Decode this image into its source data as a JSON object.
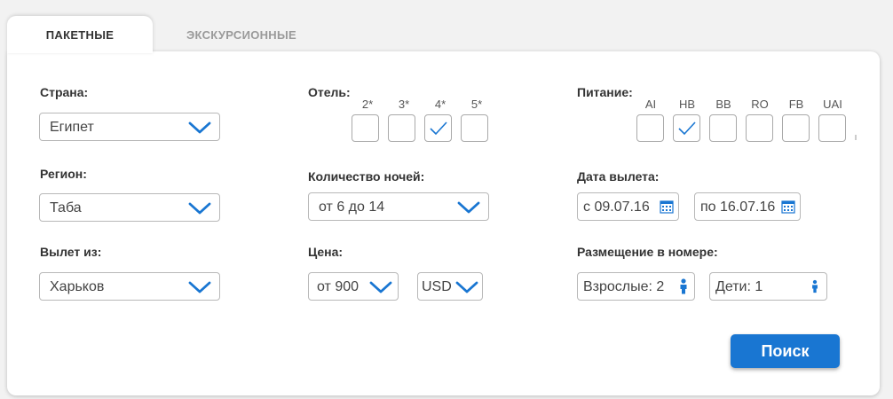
{
  "tabs": [
    {
      "label": "ПАКЕТНЫЕ",
      "active": true
    },
    {
      "label": "ЭКСКУРСИОННЫЕ",
      "active": false
    }
  ],
  "country": {
    "label": "Страна:",
    "value": "Египет"
  },
  "region": {
    "label": "Регион:",
    "value": "Таба"
  },
  "departure_from": {
    "label": "Вылет из:",
    "value": "Харьков"
  },
  "hotel": {
    "label": "Отель:",
    "options": [
      {
        "label": "2*",
        "checked": false
      },
      {
        "label": "3*",
        "checked": false
      },
      {
        "label": "4*",
        "checked": true
      },
      {
        "label": "5*",
        "checked": false
      }
    ]
  },
  "nights": {
    "label": "Количество ночей:",
    "value": "от 6 до 14"
  },
  "price": {
    "label": "Цена:",
    "value": "от 900",
    "currency": "USD"
  },
  "meals": {
    "label": "Питание:",
    "options": [
      {
        "label": "AI",
        "checked": false
      },
      {
        "label": "HB",
        "checked": true
      },
      {
        "label": "BB",
        "checked": false
      },
      {
        "label": "RO",
        "checked": false
      },
      {
        "label": "FB",
        "checked": false
      },
      {
        "label": "UAI",
        "checked": false
      }
    ]
  },
  "departure_date": {
    "label": "Дата вылета:",
    "from": "с 09.07.16",
    "to": "по 16.07.16"
  },
  "accommodation": {
    "label": "Размещение в номере:",
    "adults": "Взрослые: 2",
    "children": "Дети: 1"
  },
  "search_button": "Поиск",
  "colors": {
    "accent": "#1976d2",
    "border": "#b8b8b8",
    "text": "#333333"
  },
  "icons": [
    "chevron-down-icon",
    "checkmark-icon",
    "calendar-icon",
    "person-icon"
  ]
}
